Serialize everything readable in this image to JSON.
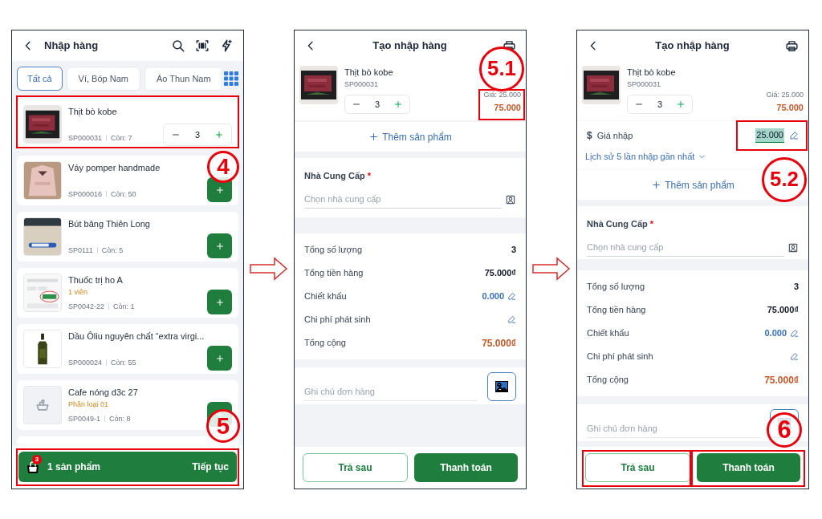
{
  "list_screen": {
    "title": "Nhập hàng",
    "tabs": [
      {
        "label": "Tất cả",
        "selected": true
      },
      {
        "label": "Ví, Bóp Nam",
        "selected": false
      },
      {
        "label": "Áo Thun Nam",
        "selected": false
      }
    ],
    "products": [
      {
        "name": "Thịt bò kobe",
        "code": "SP000031",
        "stock": "Còn: 7",
        "kind": "stepper",
        "quantity": "3"
      },
      {
        "name": "Váy pomper handmade",
        "code": "SP000016",
        "stock": "Còn: 50",
        "kind": "add"
      },
      {
        "name": "Bút bảng Thiên Long",
        "code": "SP0111",
        "stock": "Còn: 5",
        "kind": "add"
      },
      {
        "name": "Thuốc trị ho A",
        "variant": "1 viên",
        "code": "SP0042-22",
        "stock": "Còn: 1",
        "kind": "add"
      },
      {
        "name": "Dầu Ôliu nguyên chất “extra virgi...",
        "code": "SP000024",
        "stock": "Còn: 55",
        "kind": "add"
      },
      {
        "name": "Cafe nóng d3c 27",
        "variant": "Phân loại 01",
        "code": "SP0049-1",
        "stock": "Còn: 8",
        "kind": "add"
      }
    ],
    "cart": {
      "badge": "3",
      "summary": "1 sản phẩm",
      "action": "Tiếp tục"
    },
    "callouts": [
      "4",
      "5"
    ]
  },
  "order_screen": {
    "title": "Tạo nhập hàng",
    "product": {
      "name": "Thịt bò kobe",
      "code": "SP000031",
      "quantity": "3",
      "unit_price": "Giá: 25.000",
      "line_total": "75.000"
    },
    "add_product": "Thêm sản phẩm",
    "supplier": {
      "label": "Nhà Cung Cấp",
      "required_mark": "*",
      "placeholder": "Chọn nhà cung cấp"
    },
    "summary": [
      {
        "label": "Tổng số lượng",
        "value": "3",
        "kind": "plain"
      },
      {
        "label": "Tổng tiền hàng",
        "value": "75.000₫",
        "kind": "plain"
      },
      {
        "label": "Chiết khấu",
        "value": "0.000",
        "kind": "editable"
      },
      {
        "label": "Chi phí phát sinh",
        "kind": "editable"
      },
      {
        "label": "Tổng cộng",
        "value": "75.000₫",
        "kind": "total"
      }
    ],
    "note": {
      "placeholder": "Ghi chú đơn hàng"
    },
    "buttons": [
      {
        "label": "Trả sau",
        "kind": "outline"
      },
      {
        "label": "Thanh toán",
        "kind": "primary"
      }
    ],
    "callouts": [
      "5.1"
    ]
  },
  "price_screen": {
    "title": "Tạo nhập hàng",
    "product": {
      "name": "Thịt bò kobe",
      "code": "SP000031",
      "quantity": "3",
      "unit_price": "Giá: 25.000",
      "line_total": "75.000"
    },
    "purchase_price": {
      "symbol": "$",
      "label": "Giá nhập",
      "value": "25.000",
      "selected": true
    },
    "history_link": "Lịch sử 5 lần nhập gần nhất",
    "add_product": "Thêm sản phẩm",
    "supplier": {
      "label": "Nhà Cung Cấp",
      "required_mark": "*",
      "placeholder": "Chọn nhà cung cấp"
    },
    "summary": [
      {
        "label": "Tổng số lượng",
        "value": "3",
        "kind": "plain"
      },
      {
        "label": "Tổng tiền hàng",
        "value": "75.000₫",
        "kind": "plain"
      },
      {
        "label": "Chiết khấu",
        "value": "0.000",
        "kind": "editable"
      },
      {
        "label": "Chi phí phát sinh",
        "kind": "editable"
      },
      {
        "label": "Tổng cộng",
        "value": "75.000₫",
        "kind": "total"
      }
    ],
    "note": {
      "placeholder": "Ghi chú đơn hàng"
    },
    "buttons": [
      {
        "label": "Trả sau",
        "kind": "outline"
      },
      {
        "label": "Thanh toán",
        "kind": "primary"
      }
    ],
    "callouts": [
      "5.2",
      "6"
    ]
  }
}
